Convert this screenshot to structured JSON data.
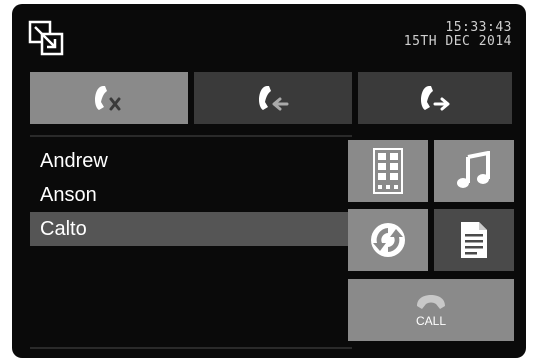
{
  "header": {
    "time": "15:33:43",
    "date": "15TH DEC 2014",
    "logo_icon": "window-switch-icon"
  },
  "tabs": [
    {
      "name": "missed-calls",
      "icon": "phone-missed-icon",
      "active": true
    },
    {
      "name": "incoming-calls",
      "icon": "phone-incoming-icon",
      "active": false
    },
    {
      "name": "outgoing-calls",
      "icon": "phone-outgoing-icon",
      "active": false
    }
  ],
  "contacts": [
    {
      "name": "Andrew",
      "selected": false
    },
    {
      "name": "Anson",
      "selected": false
    },
    {
      "name": "Calto",
      "selected": true
    }
  ],
  "actions": {
    "keypad_icon": "keypad-icon",
    "music_icon": "music-note-icon",
    "sync_icon": "sync-icon",
    "notes_icon": "document-icon",
    "call_label": "CALL",
    "call_icon": "phone-handset-icon"
  },
  "colors": {
    "background": "#0a0a0a",
    "tile_light": "#8a8a8a",
    "tile_dark": "#4a4a4a",
    "tab_inactive": "#3a3a3a",
    "selected_row": "#555555",
    "text": "#ffffff"
  }
}
